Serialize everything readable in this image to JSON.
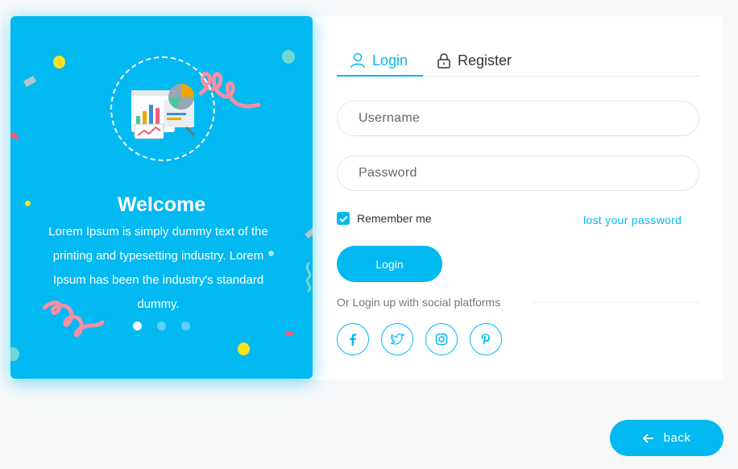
{
  "welcome_panel": {
    "title": "Welcome",
    "text": "Lorem Ipsum is simply dummy text of the printing and typesetting industry. Lorem Ipsum has been the industry's standard dummy.",
    "carousel_dots": 3,
    "active_dot": 1
  },
  "tabs": [
    {
      "label": "Login",
      "icon": "user-icon",
      "active": true
    },
    {
      "label": "Register",
      "icon": "lock-icon",
      "active": false
    }
  ],
  "form": {
    "username_placeholder": "Username",
    "password_placeholder": "Password",
    "remember_label": "Remember me",
    "remember_checked": true,
    "lost_password": "lost your password",
    "login_button": "Login"
  },
  "social": {
    "caption": "Or Login up with social platforms",
    "platforms": [
      "facebook-icon",
      "twitter-icon",
      "instagram-icon",
      "pinterest-icon"
    ]
  },
  "back_button": {
    "label": "back",
    "icon": "arrow-left-icon"
  },
  "colors": {
    "accent": "#02b9f2",
    "background": "#f7f8f9",
    "card": "#ffffff"
  }
}
